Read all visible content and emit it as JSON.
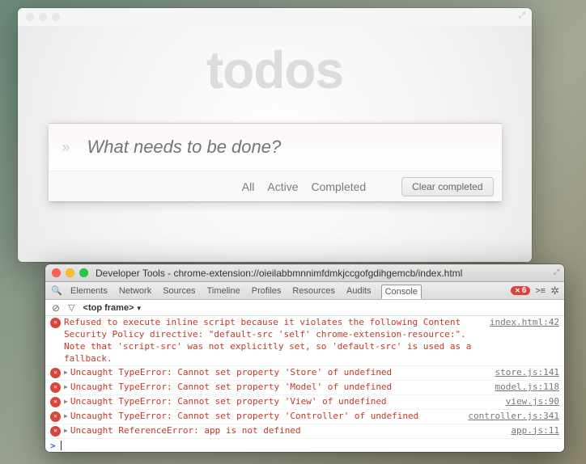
{
  "app": {
    "title": "todos",
    "input_placeholder": "What needs to be done?",
    "toggle_all_glyph": "»",
    "filters": {
      "all": "All",
      "active": "Active",
      "completed": "Completed"
    },
    "clear_label": "Clear completed"
  },
  "devtools": {
    "window_title": "Developer Tools - chrome-extension://oieilabbmnnimfdmkjccgofgdihgemcb/index.html",
    "tabs": [
      "Elements",
      "Network",
      "Sources",
      "Timeline",
      "Profiles",
      "Resources",
      "Audits",
      "Console"
    ],
    "active_tab": "Console",
    "error_count": "6",
    "frame_label": "<top frame>",
    "logs": [
      {
        "expandable": false,
        "msg": "Refused to execute inline script because it violates the following Content Security Policy directive: \"default-src 'self' chrome-extension-resource:\". Note that 'script-src' was not explicitly set, so 'default-src' is used as a fallback.",
        "src": "index.html:42"
      },
      {
        "expandable": true,
        "msg": "Uncaught TypeError: Cannot set property 'Store' of undefined",
        "src": "store.js:141"
      },
      {
        "expandable": true,
        "msg": "Uncaught TypeError: Cannot set property 'Model' of undefined",
        "src": "model.js:118"
      },
      {
        "expandable": true,
        "msg": "Uncaught TypeError: Cannot set property 'View' of undefined",
        "src": "view.js:90"
      },
      {
        "expandable": true,
        "msg": "Uncaught TypeError: Cannot set property 'Controller' of undefined",
        "src": "controller.js:341"
      },
      {
        "expandable": true,
        "msg": "Uncaught ReferenceError: app is not defined",
        "src": "app.js:11"
      }
    ]
  }
}
